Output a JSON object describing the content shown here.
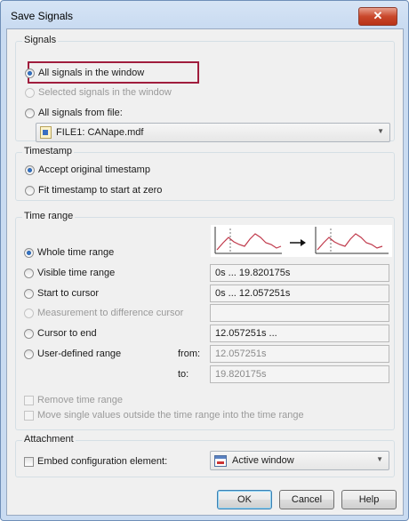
{
  "window": {
    "title": "Save Signals",
    "close_glyph": "✕"
  },
  "signals": {
    "legend": "Signals",
    "all_in_window": "All signals in the window",
    "selected_in_window": "Selected signals in the window",
    "all_from_file": "All signals from file:",
    "file_value": "FILE1: CANape.mdf"
  },
  "timestamp": {
    "legend": "Timestamp",
    "accept_original": "Accept original timestamp",
    "fit_to_zero": "Fit timestamp to start at zero"
  },
  "time_range": {
    "legend": "Time range",
    "whole": "Whole time range",
    "visible": "Visible time range",
    "visible_value": "0s  ...  19.820175s",
    "start_to_cursor": "Start to cursor",
    "start_to_cursor_value": "0s  ...  12.057251s",
    "measurement_diff": "Measurement to difference cursor",
    "measurement_diff_value": "",
    "cursor_to_end": "Cursor to end",
    "cursor_to_end_value": "12.057251s  ...",
    "user_defined": "User-defined range",
    "from_label": "from:",
    "from_value": "12.057251s",
    "to_label": "to:",
    "to_value": "19.820175s",
    "remove": "Remove time range",
    "move_single": "Move single values outside the time range into the time range"
  },
  "attachment": {
    "legend": "Attachment",
    "embed": "Embed configuration element:",
    "combo_value": "Active window"
  },
  "buttons": {
    "ok": "OK",
    "cancel": "Cancel",
    "help": "Help"
  },
  "colors": {
    "highlight": "#a01d3d",
    "graph_line": "#c0394b",
    "graph_axis": "#333333"
  }
}
